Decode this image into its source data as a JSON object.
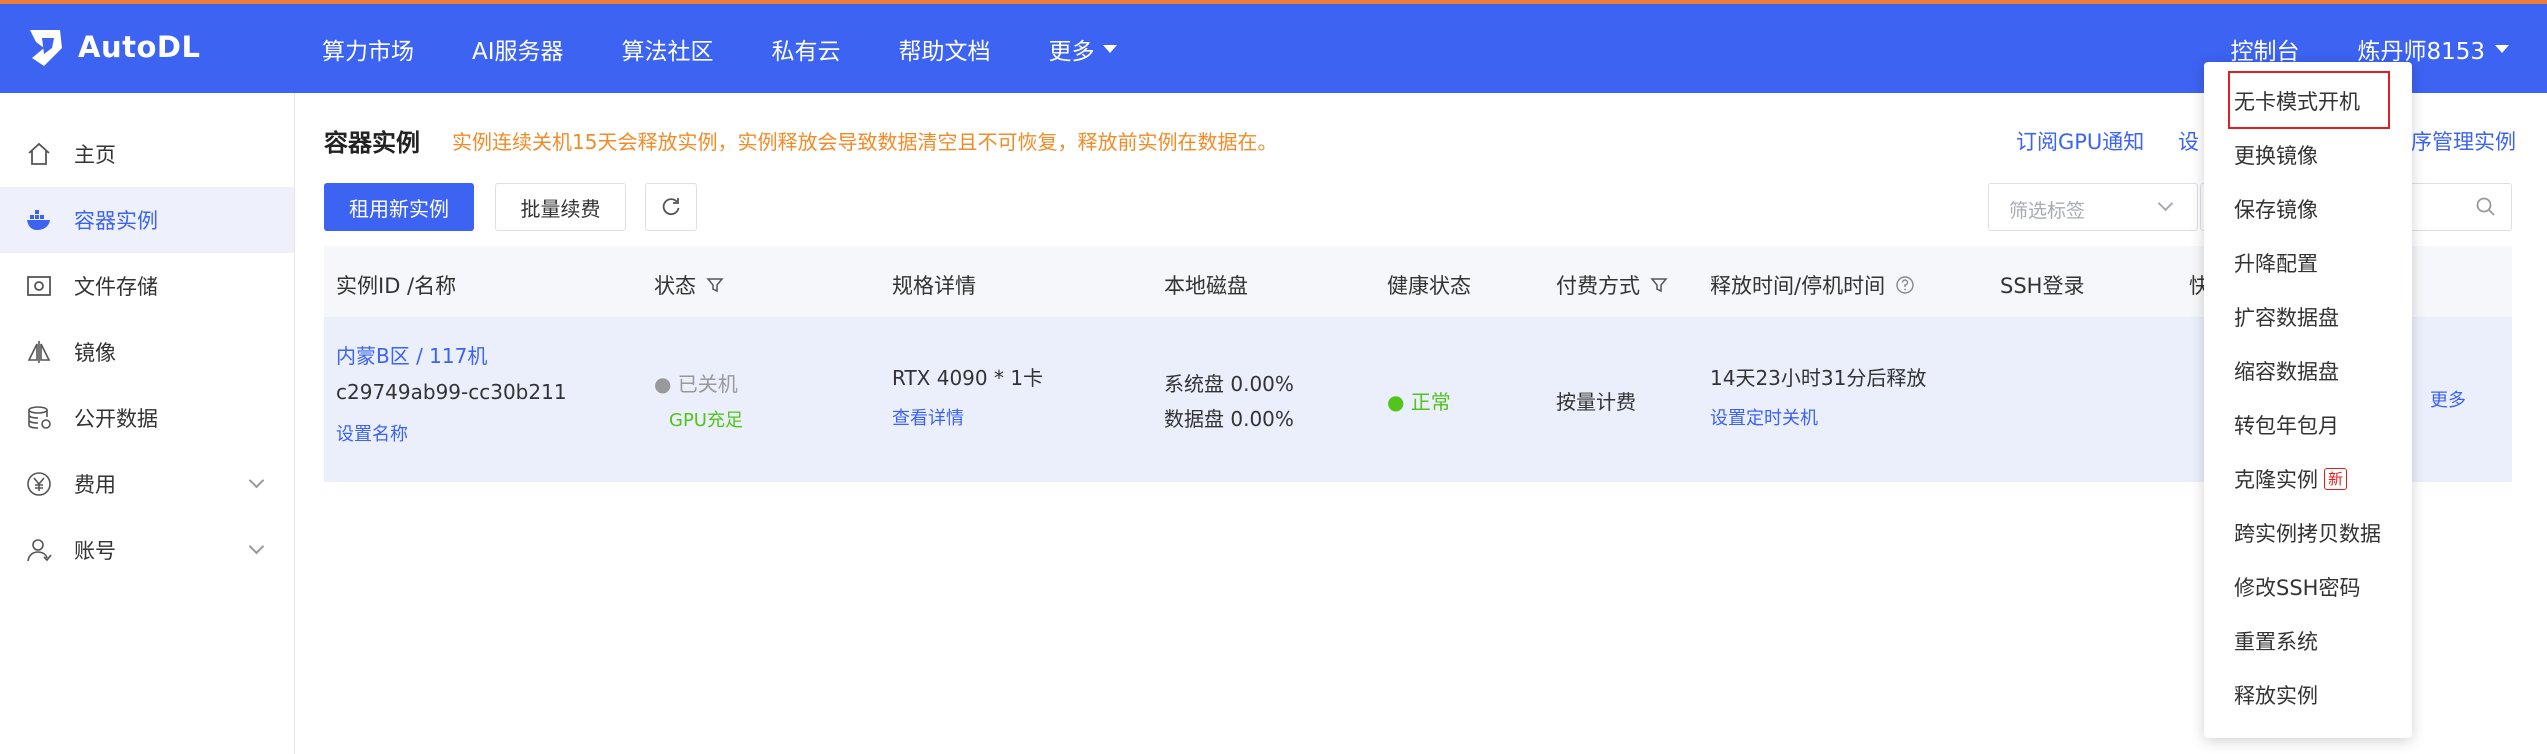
{
  "brand": {
    "name": "AutoDL"
  },
  "nav": [
    {
      "label": "算力市场"
    },
    {
      "label": "AI服务器"
    },
    {
      "label": "算法社区"
    },
    {
      "label": "私有云"
    },
    {
      "label": "帮助文档"
    },
    {
      "label": "更多"
    }
  ],
  "top_right": {
    "console": "控制台",
    "user": "炼丹师8153"
  },
  "sidebar": {
    "items": [
      {
        "label": "主页",
        "icon": "home-icon"
      },
      {
        "label": "容器实例",
        "icon": "docker-icon"
      },
      {
        "label": "文件存储",
        "icon": "storage-icon"
      },
      {
        "label": "镜像",
        "icon": "image-icon"
      },
      {
        "label": "公开数据",
        "icon": "database-icon"
      },
      {
        "label": "费用",
        "icon": "yen-icon"
      },
      {
        "label": "账号",
        "icon": "user-icon"
      }
    ]
  },
  "page": {
    "title": "容器实例",
    "notice": "实例连续关机15天会释放实例，实例释放会导致数据清空且不可恢复，释放前实例在数据在。",
    "notify_link": "订阅GPU通知",
    "set_link": "设",
    "manage_link": "序管理实例",
    "rent_button": "租用新实例",
    "batch_button": "批量续费",
    "tag_placeholder": "筛选标签"
  },
  "table": {
    "headers": [
      "实例ID /名称",
      "状态",
      "规格详情",
      "本地磁盘",
      "健康状态",
      "付费方式",
      "释放时间/停机时间",
      "SSH登录",
      "快"
    ],
    "row": {
      "region": "内蒙B区 / 117机",
      "id": "c29749ab99-cc30b211",
      "set_name": "设置名称",
      "status": "● 已关机",
      "gpu_status": "GPU充足",
      "spec": "RTX 4090 * 1卡",
      "spec_link": "查看详情",
      "disk_sys": "系统盘 0.00%",
      "disk_data": "数据盘 0.00%",
      "health": "● 正常",
      "billing": "按量计费",
      "release": "14天23小时31分后释放",
      "timer_link": "设置定时关机",
      "more": "更多"
    }
  },
  "dropdown": {
    "items": [
      {
        "label": "无卡模式开机"
      },
      {
        "label": "更换镜像"
      },
      {
        "label": "保存镜像"
      },
      {
        "label": "升降配置"
      },
      {
        "label": "扩容数据盘"
      },
      {
        "label": "缩容数据盘"
      },
      {
        "label": "转包年包月"
      },
      {
        "label": "克隆实例"
      },
      {
        "label": "跨实例拷贝数据"
      },
      {
        "label": "修改SSH密码"
      },
      {
        "label": "重置系统"
      },
      {
        "label": "释放实例"
      }
    ],
    "new_badge": "新"
  },
  "colors": {
    "primary": "#3c63f2",
    "warning": "#f08c28",
    "success": "#52c41a",
    "highlight": "#e02020"
  }
}
